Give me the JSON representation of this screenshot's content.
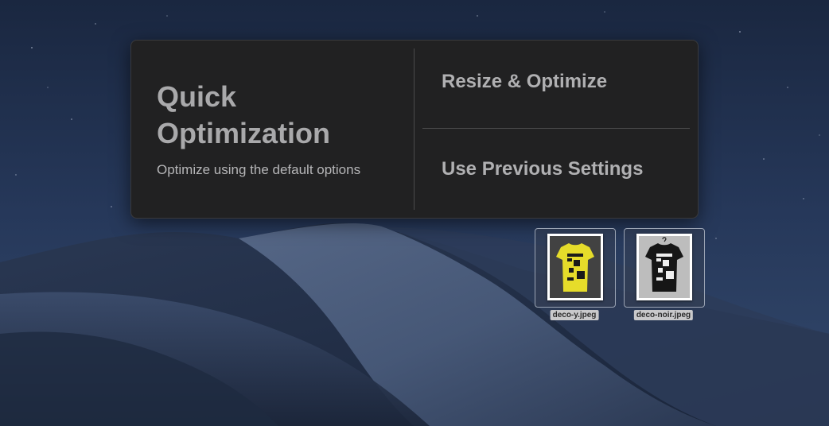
{
  "panel": {
    "quick": {
      "title": "Quick Optimization",
      "subtitle": "Optimize using the default options"
    },
    "options": [
      {
        "label": "Resize & Optimize"
      },
      {
        "label": "Use Previous Settings"
      }
    ]
  },
  "files": [
    {
      "name": "deco-y.jpeg",
      "icon": "yellow-tshirt-image-icon",
      "shirt_color": "#e6dc2a",
      "background_color": "#3a3a3a"
    },
    {
      "name": "deco-noir.jpeg",
      "icon": "black-tshirt-image-icon",
      "shirt_color": "#161616",
      "background_color": "#bdbdbd"
    }
  ],
  "colors": {
    "panel_background": "#212122",
    "panel_text": "#b0b0b2"
  }
}
